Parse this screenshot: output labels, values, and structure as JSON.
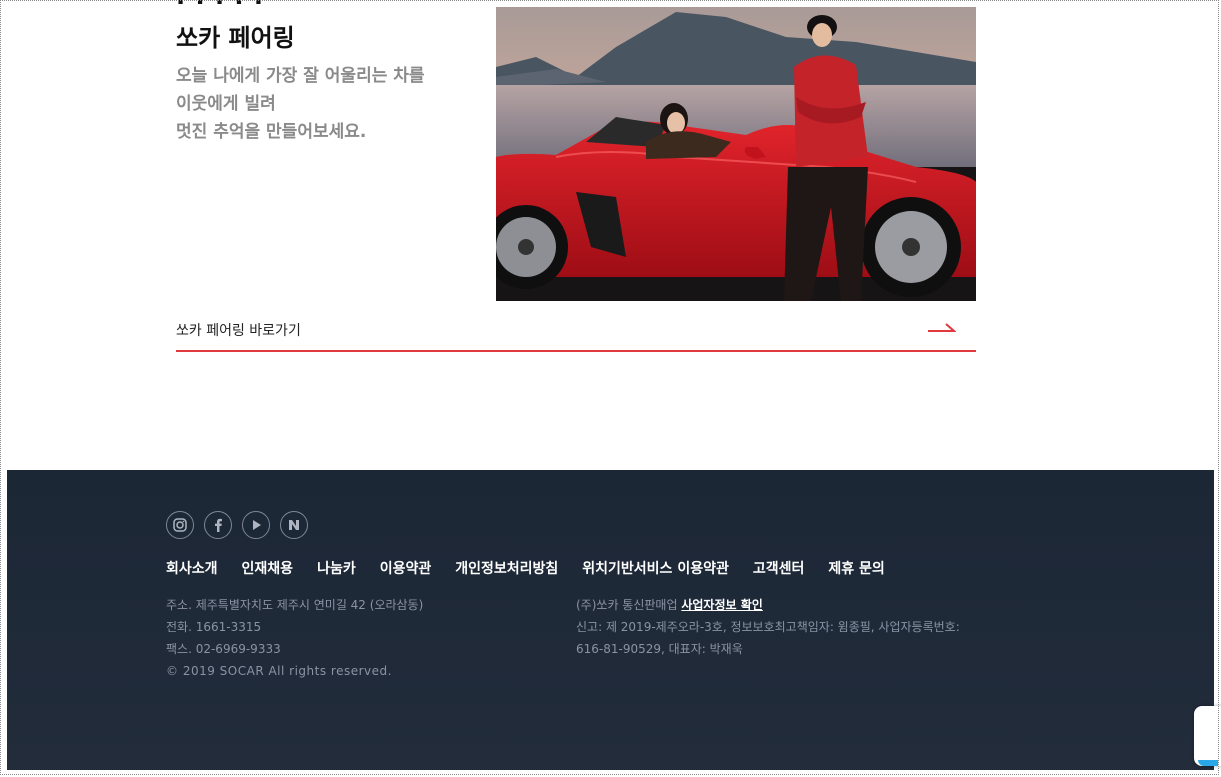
{
  "section": {
    "title": "쏘카 페어링",
    "desc_lines": [
      "오늘 나에게 가장 잘 어울리는 차를",
      "이웃에게 빌려",
      "멋진 추억을 만들어보세요."
    ],
    "link_label": "쏘카 페어링 바로가기"
  },
  "footer": {
    "social_icons": [
      "instagram-icon",
      "facebook-icon",
      "youtube-icon",
      "naver-icon"
    ],
    "menu": [
      "회사소개",
      "인재채용",
      "나눔카",
      "이용약관",
      "개인정보처리방침",
      "위치기반서비스 이용약관",
      "고객센터",
      "제휴 문의"
    ],
    "address": "주소. 제주특별자치도 제주시 연미길 42 (오라삼동)",
    "phone_label": "전화.",
    "phone": "1661-3315",
    "fax": "팩스. 02-6969-9333",
    "copyright": "© 2019 SOCAR All rights reserved.",
    "business_prefix": "(주)쏘카 통신판매업",
    "business_link": "사업자정보 확인",
    "registration_line1": "신고: 제 2019-제주오라-3호, 정보보호최고책임자: 윔종필, 사업자등록번호:",
    "registration_line2": "616-81-90529, 대표자: 박재욱"
  },
  "colors": {
    "accent": "#e0393e",
    "footer_bg": "#1f2a39",
    "floating_accent": "#2aa7e6"
  }
}
